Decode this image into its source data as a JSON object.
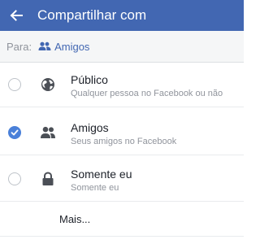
{
  "topbar": {
    "back_icon": "arrow-left-icon",
    "title": "Compartilhar com",
    "color": "#4267b2"
  },
  "audience": {
    "prefix": "Para:",
    "icon": "friends-icon",
    "value": "Amigos"
  },
  "options": [
    {
      "title": "Público",
      "subtitle": "Qualquer pessoa no Facebook ou não",
      "icon": "globe-icon",
      "selected": false
    },
    {
      "title": "Amigos",
      "subtitle": "Seus amigos no Facebook",
      "icon": "friends-icon",
      "selected": true
    },
    {
      "title": "Somente eu",
      "subtitle": "Somente eu",
      "icon": "lock-icon",
      "selected": false
    }
  ],
  "more": {
    "label": "Mais..."
  },
  "colors": {
    "accent": "#4a80d9",
    "link": "#4267b2",
    "muted": "#90949c"
  }
}
